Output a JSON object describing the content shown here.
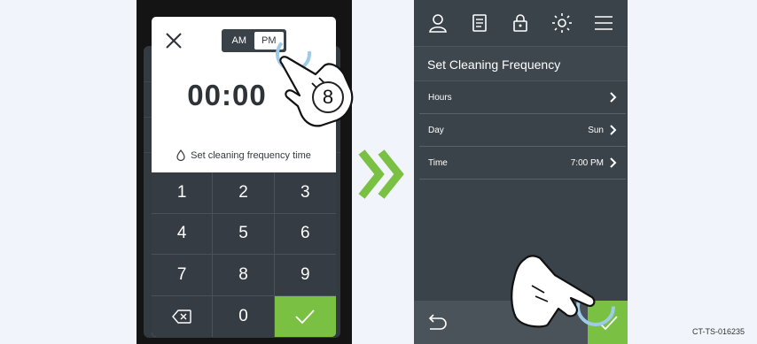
{
  "left_screen": {
    "ampm_toggle": {
      "am_label": "AM",
      "pm_label": "PM",
      "selected": "PM"
    },
    "time_value": "00:00",
    "hint_text": "Set cleaning frequency time",
    "keypad": {
      "keys": [
        "1",
        "2",
        "3",
        "4",
        "5",
        "6",
        "7",
        "8",
        "9"
      ],
      "zero": "0"
    },
    "step_number": "8"
  },
  "right_screen": {
    "top_icons": [
      "user-icon",
      "document-icon",
      "lock-icon",
      "brightness-icon",
      "menu-icon"
    ],
    "title": "Set Cleaning Frequency",
    "rows": [
      {
        "label": "Hours",
        "value": ""
      },
      {
        "label": "Day",
        "value": "Sun"
      },
      {
        "label": "Time",
        "value": "7:00 PM"
      }
    ]
  },
  "colors": {
    "accent_green": "#7ac143",
    "panel_dark": "#3b434a",
    "keypad_dark": "#353c43"
  },
  "reference_code": "CT-TS-016235"
}
